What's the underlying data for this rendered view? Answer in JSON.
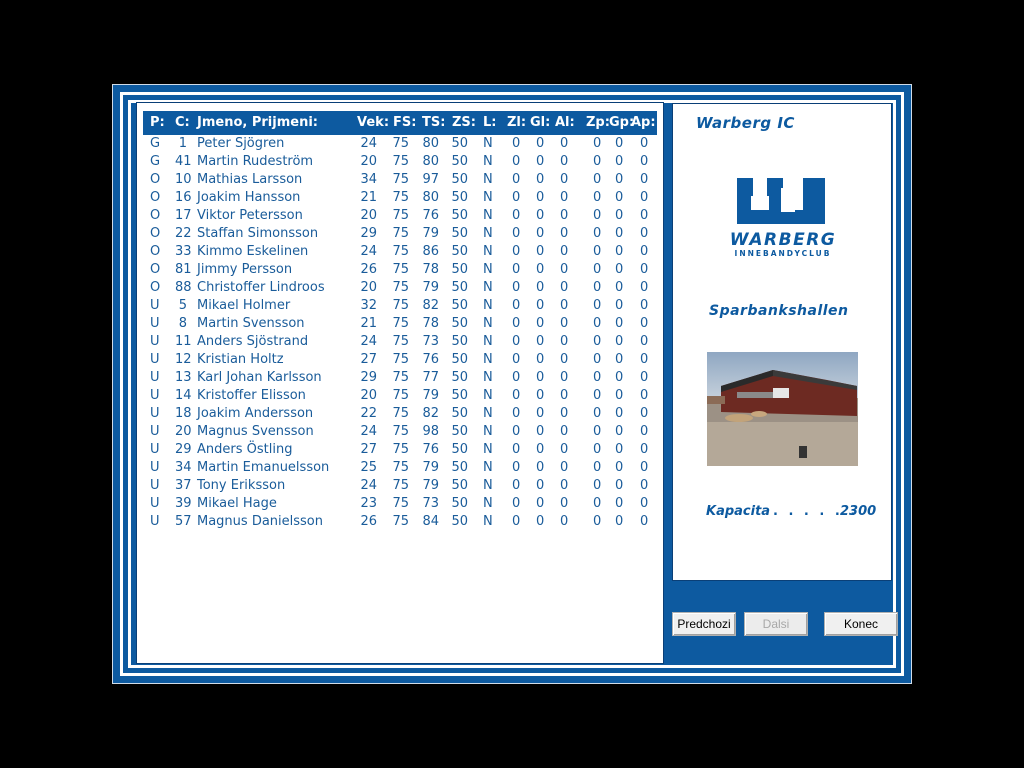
{
  "roster": {
    "headers": {
      "pos": "P:",
      "num": "C:",
      "name": "Jmeno, Prijmeni:",
      "age": "Vek:",
      "fs": "FS:",
      "ts": "TS:",
      "zs": "ZS:",
      "l": "L:",
      "zl": "Zl:",
      "gl": "Gl:",
      "al": "Al:",
      "zp": "Zp:",
      "gp": "Gp:",
      "ap": "Ap:"
    },
    "rows": [
      {
        "pos": "G",
        "num": "1",
        "name": "Peter Sjögren",
        "age": "24",
        "fs": "75",
        "ts": "80",
        "zs": "50",
        "l": "N",
        "zl": "0",
        "gl": "0",
        "al": "0",
        "zp": "0",
        "gp": "0",
        "ap": "0"
      },
      {
        "pos": "G",
        "num": "41",
        "name": "Martin Rudeström",
        "age": "20",
        "fs": "75",
        "ts": "80",
        "zs": "50",
        "l": "N",
        "zl": "0",
        "gl": "0",
        "al": "0",
        "zp": "0",
        "gp": "0",
        "ap": "0"
      },
      {
        "pos": "O",
        "num": "10",
        "name": "Mathias Larsson",
        "age": "34",
        "fs": "75",
        "ts": "97",
        "zs": "50",
        "l": "N",
        "zl": "0",
        "gl": "0",
        "al": "0",
        "zp": "0",
        "gp": "0",
        "ap": "0"
      },
      {
        "pos": "O",
        "num": "16",
        "name": "Joakim Hansson",
        "age": "21",
        "fs": "75",
        "ts": "80",
        "zs": "50",
        "l": "N",
        "zl": "0",
        "gl": "0",
        "al": "0",
        "zp": "0",
        "gp": "0",
        "ap": "0"
      },
      {
        "pos": "O",
        "num": "17",
        "name": "Viktor Petersson",
        "age": "20",
        "fs": "75",
        "ts": "76",
        "zs": "50",
        "l": "N",
        "zl": "0",
        "gl": "0",
        "al": "0",
        "zp": "0",
        "gp": "0",
        "ap": "0"
      },
      {
        "pos": "O",
        "num": "22",
        "name": "Staffan Simonsson",
        "age": "29",
        "fs": "75",
        "ts": "79",
        "zs": "50",
        "l": "N",
        "zl": "0",
        "gl": "0",
        "al": "0",
        "zp": "0",
        "gp": "0",
        "ap": "0"
      },
      {
        "pos": "O",
        "num": "33",
        "name": "Kimmo Eskelinen",
        "age": "24",
        "fs": "75",
        "ts": "86",
        "zs": "50",
        "l": "N",
        "zl": "0",
        "gl": "0",
        "al": "0",
        "zp": "0",
        "gp": "0",
        "ap": "0"
      },
      {
        "pos": "O",
        "num": "81",
        "name": "Jimmy Persson",
        "age": "26",
        "fs": "75",
        "ts": "78",
        "zs": "50",
        "l": "N",
        "zl": "0",
        "gl": "0",
        "al": "0",
        "zp": "0",
        "gp": "0",
        "ap": "0"
      },
      {
        "pos": "O",
        "num": "88",
        "name": "Christoffer Lindroos",
        "age": "20",
        "fs": "75",
        "ts": "79",
        "zs": "50",
        "l": "N",
        "zl": "0",
        "gl": "0",
        "al": "0",
        "zp": "0",
        "gp": "0",
        "ap": "0"
      },
      {
        "pos": "U",
        "num": "5",
        "name": "Mikael Holmer",
        "age": "32",
        "fs": "75",
        "ts": "82",
        "zs": "50",
        "l": "N",
        "zl": "0",
        "gl": "0",
        "al": "0",
        "zp": "0",
        "gp": "0",
        "ap": "0"
      },
      {
        "pos": "U",
        "num": "8",
        "name": "Martin Svensson",
        "age": "21",
        "fs": "75",
        "ts": "78",
        "zs": "50",
        "l": "N",
        "zl": "0",
        "gl": "0",
        "al": "0",
        "zp": "0",
        "gp": "0",
        "ap": "0"
      },
      {
        "pos": "U",
        "num": "11",
        "name": "Anders Sjöstrand",
        "age": "24",
        "fs": "75",
        "ts": "73",
        "zs": "50",
        "l": "N",
        "zl": "0",
        "gl": "0",
        "al": "0",
        "zp": "0",
        "gp": "0",
        "ap": "0"
      },
      {
        "pos": "U",
        "num": "12",
        "name": "Kristian Holtz",
        "age": "27",
        "fs": "75",
        "ts": "76",
        "zs": "50",
        "l": "N",
        "zl": "0",
        "gl": "0",
        "al": "0",
        "zp": "0",
        "gp": "0",
        "ap": "0"
      },
      {
        "pos": "U",
        "num": "13",
        "name": "Karl Johan Karlsson",
        "age": "29",
        "fs": "75",
        "ts": "77",
        "zs": "50",
        "l": "N",
        "zl": "0",
        "gl": "0",
        "al": "0",
        "zp": "0",
        "gp": "0",
        "ap": "0"
      },
      {
        "pos": "U",
        "num": "14",
        "name": "Kristoffer Elisson",
        "age": "20",
        "fs": "75",
        "ts": "79",
        "zs": "50",
        "l": "N",
        "zl": "0",
        "gl": "0",
        "al": "0",
        "zp": "0",
        "gp": "0",
        "ap": "0"
      },
      {
        "pos": "U",
        "num": "18",
        "name": "Joakim Andersson",
        "age": "22",
        "fs": "75",
        "ts": "82",
        "zs": "50",
        "l": "N",
        "zl": "0",
        "gl": "0",
        "al": "0",
        "zp": "0",
        "gp": "0",
        "ap": "0"
      },
      {
        "pos": "U",
        "num": "20",
        "name": "Magnus Svensson",
        "age": "24",
        "fs": "75",
        "ts": "98",
        "zs": "50",
        "l": "N",
        "zl": "0",
        "gl": "0",
        "al": "0",
        "zp": "0",
        "gp": "0",
        "ap": "0"
      },
      {
        "pos": "U",
        "num": "29",
        "name": "Anders Östling",
        "age": "27",
        "fs": "75",
        "ts": "76",
        "zs": "50",
        "l": "N",
        "zl": "0",
        "gl": "0",
        "al": "0",
        "zp": "0",
        "gp": "0",
        "ap": "0"
      },
      {
        "pos": "U",
        "num": "34",
        "name": "Martin Emanuelsson",
        "age": "25",
        "fs": "75",
        "ts": "79",
        "zs": "50",
        "l": "N",
        "zl": "0",
        "gl": "0",
        "al": "0",
        "zp": "0",
        "gp": "0",
        "ap": "0"
      },
      {
        "pos": "U",
        "num": "37",
        "name": "Tony Eriksson",
        "age": "24",
        "fs": "75",
        "ts": "79",
        "zs": "50",
        "l": "N",
        "zl": "0",
        "gl": "0",
        "al": "0",
        "zp": "0",
        "gp": "0",
        "ap": "0"
      },
      {
        "pos": "U",
        "num": "39",
        "name": "Mikael Hage",
        "age": "23",
        "fs": "75",
        "ts": "73",
        "zs": "50",
        "l": "N",
        "zl": "0",
        "gl": "0",
        "al": "0",
        "zp": "0",
        "gp": "0",
        "ap": "0"
      },
      {
        "pos": "U",
        "num": "57",
        "name": "Magnus Danielsson",
        "age": "26",
        "fs": "75",
        "ts": "84",
        "zs": "50",
        "l": "N",
        "zl": "0",
        "gl": "0",
        "al": "0",
        "zp": "0",
        "gp": "0",
        "ap": "0"
      }
    ]
  },
  "info": {
    "team_name": "Warberg IC",
    "logo_text": "WARBERG",
    "logo_subtext": "INNEBANDYCLUB",
    "arena_name": "Sparbankshallen",
    "capacity_label": "Kapacita",
    "capacity_dots": ". . . . . .",
    "capacity_value": "2300",
    "photo": "arena-photo"
  },
  "buttons": {
    "prev": "Predchozi",
    "next": "Dalsi",
    "end": "Konec"
  },
  "colors": {
    "frame_blue": "#0d5aa0",
    "text_blue": "#1a5c9a",
    "background": "#000000"
  }
}
